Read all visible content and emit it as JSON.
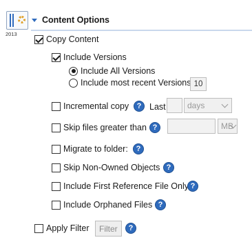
{
  "app_icon": {
    "icon": "sharepoint-app-icon",
    "year": "2013"
  },
  "header": {
    "title": "Content Options",
    "caret_icon": "triangle-down-icon"
  },
  "copy_content": {
    "label": "Copy Content",
    "checked": true
  },
  "include_versions": {
    "label": "Include Versions",
    "checked": true
  },
  "version_options": {
    "all": {
      "label": "Include All Versions",
      "selected": true
    },
    "recent": {
      "label": "Include most recent Versions",
      "selected": false,
      "value": "10"
    }
  },
  "incremental_copy": {
    "label": "Incremental copy",
    "checked": false,
    "last_label": "Last",
    "last_value": "",
    "unit": "days"
  },
  "skip_files": {
    "label": "Skip files greater than",
    "checked": false,
    "size_value": "",
    "unit": "MB"
  },
  "migrate_folder": {
    "label": "Migrate to folder:",
    "checked": false
  },
  "skip_non_owned": {
    "label": "Skip Non-Owned Objects",
    "checked": false
  },
  "first_reference": {
    "label": "Include First Reference File Only",
    "checked": false
  },
  "orphaned_files": {
    "label": "Include Orphaned Files",
    "checked": false
  },
  "apply_filter": {
    "label": "Apply Filter",
    "checked": false,
    "button_label": "Filter"
  },
  "help_glyph": "?",
  "colors": {
    "accent": "#2f6bbd",
    "gear": "#e0a22a",
    "divider": "#c9d8ec"
  }
}
